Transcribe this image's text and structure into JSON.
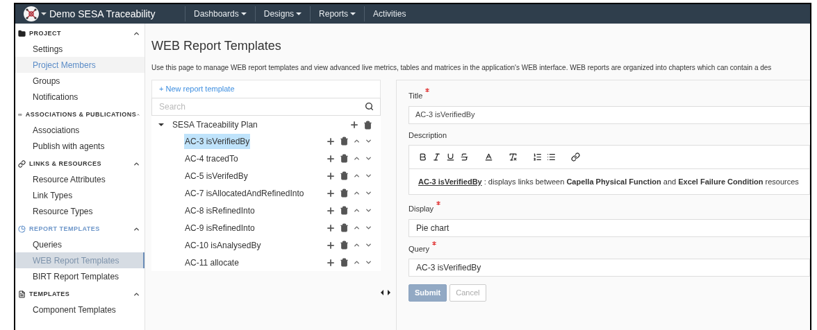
{
  "navbar": {
    "app_title": "Demo SESA Traceability",
    "menus": [
      {
        "label": "Dashboards",
        "dropdown": true
      },
      {
        "label": "Designs",
        "dropdown": true
      },
      {
        "label": "Reports",
        "dropdown": true
      },
      {
        "label": "Activities",
        "dropdown": false
      }
    ]
  },
  "sidebar": {
    "sections": [
      {
        "title": "PROJECT",
        "kind": "folder",
        "expanded": true,
        "items": [
          {
            "label": "Settings",
            "selected": false
          },
          {
            "label": "Project Members",
            "selected": false,
            "hovered": true
          },
          {
            "label": "Groups",
            "selected": false
          },
          {
            "label": "Notifications",
            "selected": false
          }
        ]
      },
      {
        "title": "ASSOCIATIONS & PUBLICATIONS",
        "kind": "links",
        "expanded": true,
        "items": [
          {
            "label": "Associations",
            "selected": false
          },
          {
            "label": "Publish with agents",
            "selected": false
          }
        ]
      },
      {
        "title": "LINKS & RESOURCES",
        "kind": "link",
        "expanded": true,
        "items": [
          {
            "label": "Resource Attributes",
            "selected": false
          },
          {
            "label": "Link Types",
            "selected": false
          },
          {
            "label": "Resource Types",
            "selected": false
          }
        ]
      },
      {
        "title": "REPORT TEMPLATES",
        "kind": "chart",
        "expanded": true,
        "active": true,
        "items": [
          {
            "label": "Queries",
            "selected": false
          },
          {
            "label": "WEB Report Templates",
            "selected": true
          },
          {
            "label": "BIRT Report Templates",
            "selected": false
          }
        ]
      },
      {
        "title": "TEMPLATES",
        "kind": "file",
        "expanded": true,
        "items": [
          {
            "label": "Component Templates",
            "selected": false
          }
        ]
      }
    ]
  },
  "page": {
    "title": "WEB Report Templates",
    "description": "Use this page to manage WEB report templates and view advanced live metrics, tables and matrices in the application's WEB interface. WEB reports are organized into chapters which can contain a des"
  },
  "tree": {
    "new_link": "+ New report template",
    "search": {
      "placeholder": "Search"
    },
    "root": {
      "label": "SESA Traceability Plan",
      "expanded": true,
      "children": [
        {
          "label": "AC-3 isVerifiedBy",
          "selected": true
        },
        {
          "label": "AC-4 tracedTo",
          "selected": false
        },
        {
          "label": "AC-5 isVerifedBy",
          "selected": false
        },
        {
          "label": "AC-7 isAllocatedAndRefinedInto",
          "selected": false
        },
        {
          "label": "AC-8 isRefinedInto",
          "selected": false
        },
        {
          "label": "AC-9 isRefinedInto",
          "selected": false
        },
        {
          "label": "AC-10 isAnalysedBy",
          "selected": false
        },
        {
          "label": "AC-11 allocate",
          "selected": false
        }
      ]
    }
  },
  "form": {
    "title": {
      "label": "Title",
      "required": true,
      "value": "AC-3 isVerifiedBy"
    },
    "description": {
      "label": "Description",
      "link": "AC-3 isVerifiedBy",
      "text": " : displays links between **Capella Physical Function** and **Excel Failure Condition** resources"
    },
    "display": {
      "label": "Display",
      "required": true,
      "value": "Pie chart"
    },
    "query": {
      "label": "Query",
      "required": true,
      "value": "AC-3 isVerifiedBy"
    },
    "buttons": [
      {
        "label": "Submit",
        "kind": "primary",
        "disabled": true
      },
      {
        "label": "Cancel",
        "kind": "secondary",
        "disabled": true
      }
    ]
  }
}
